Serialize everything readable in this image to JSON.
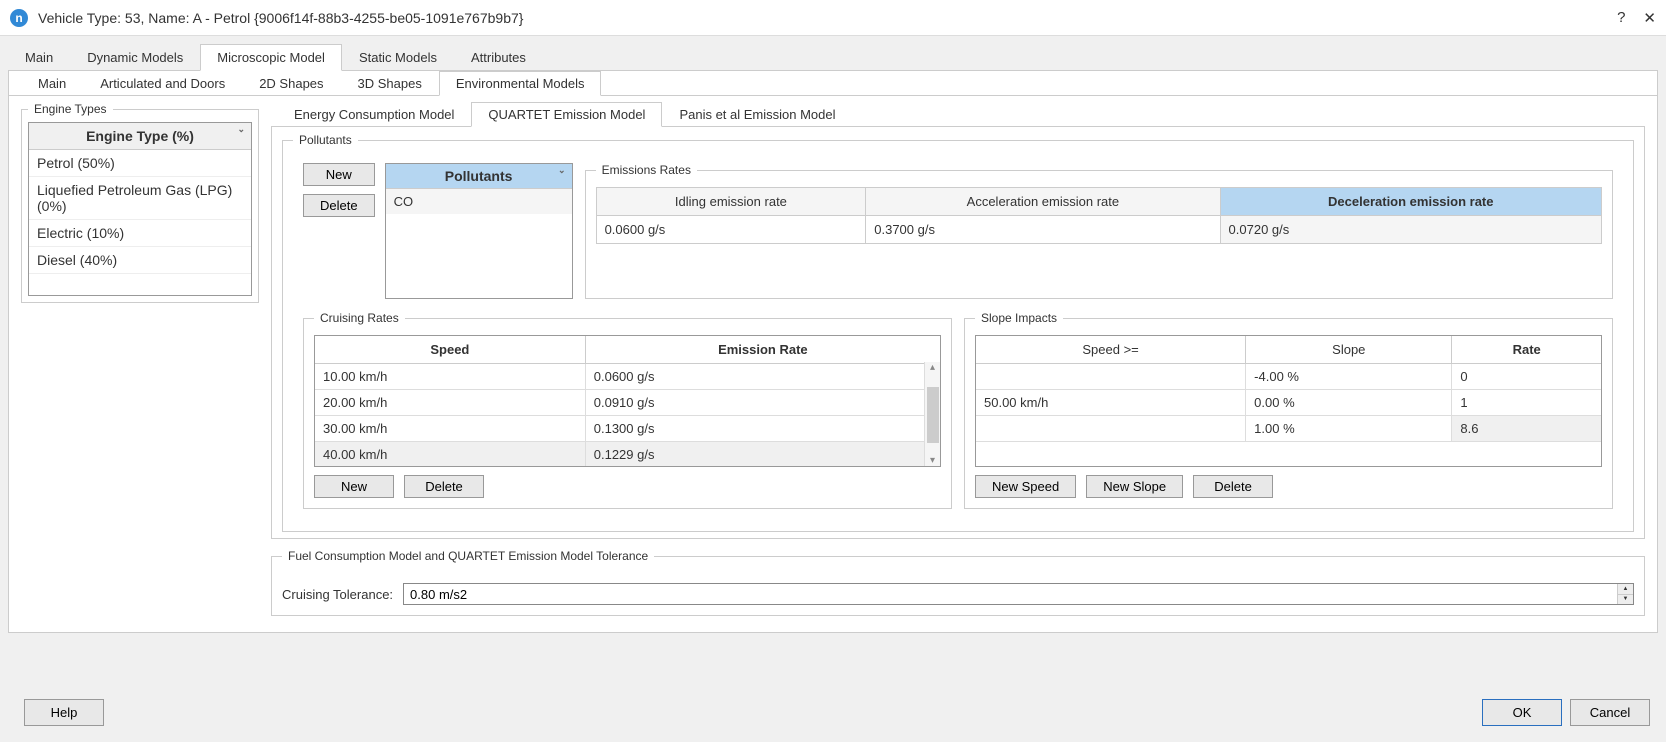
{
  "title": "Vehicle Type: 53, Name: A - Petrol  {9006f14f-88b3-4255-be05-1091e767b9b7}",
  "top_tabs": [
    "Main",
    "Dynamic Models",
    "Microscopic Model",
    "Static Models",
    "Attributes"
  ],
  "top_tab_active": "Microscopic Model",
  "sub_tabs": [
    "Main",
    "Articulated and Doors",
    "2D Shapes",
    "3D Shapes",
    "Environmental Models"
  ],
  "sub_tab_active": "Environmental Models",
  "engine_types_legend": "Engine Types",
  "engine_types_header": "Engine Type (%)",
  "engine_types": [
    "Petrol (50%)",
    "Liquefied Petroleum Gas (LPG) (0%)",
    "Electric (10%)",
    "Diesel (40%)"
  ],
  "emission_tabs": [
    "Energy Consumption Model",
    "QUARTET Emission Model",
    "Panis et al Emission Model"
  ],
  "emission_tab_active": "QUARTET Emission Model",
  "pollutants_legend": "Pollutants",
  "btn_new": "New",
  "btn_delete": "Delete",
  "pollutants_header": "Pollutants",
  "pollutants": [
    "CO"
  ],
  "emissions_rates_legend": "Emissions Rates",
  "emissions_headers": {
    "idle": "Idling emission rate",
    "accel": "Acceleration emission rate",
    "decel": "Deceleration emission rate"
  },
  "emissions_values": {
    "idle": "0.0600 g/s",
    "accel": "0.3700 g/s",
    "decel": "0.0720 g/s"
  },
  "cruising_legend": "Cruising Rates",
  "cruising_headers": {
    "speed": "Speed",
    "rate": "Emission Rate"
  },
  "cruising_rows": [
    {
      "speed": "10.00 km/h",
      "rate": "0.0600 g/s"
    },
    {
      "speed": "20.00 km/h",
      "rate": "0.0910 g/s"
    },
    {
      "speed": "30.00 km/h",
      "rate": "0.1300 g/s"
    },
    {
      "speed": "40.00 km/h",
      "rate": "0.1229 g/s"
    }
  ],
  "slope_legend": "Slope Impacts",
  "slope_headers": {
    "speed": "Speed >=",
    "slope": "Slope",
    "rate": "Rate"
  },
  "slope_rows": [
    {
      "speed": "",
      "slope": "-4.00 %",
      "rate": "0"
    },
    {
      "speed": "50.00 km/h",
      "slope": "0.00 %",
      "rate": "1"
    },
    {
      "speed": "",
      "slope": "1.00 %",
      "rate": "8.6"
    }
  ],
  "btn_new_speed": "New Speed",
  "btn_new_slope": "New Slope",
  "tolerance_legend": "Fuel Consumption Model and QUARTET Emission Model Tolerance",
  "tolerance_label": "Cruising Tolerance:",
  "tolerance_value": "0.80 m/s2",
  "btn_help": "Help",
  "btn_ok": "OK",
  "btn_cancel": "Cancel"
}
